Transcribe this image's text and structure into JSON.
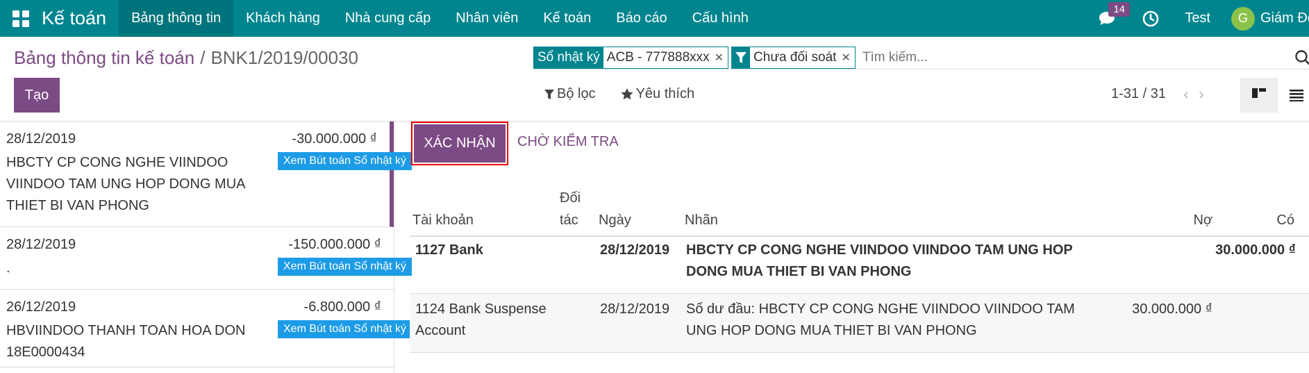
{
  "topbar": {
    "app_name": "Kế toán",
    "menu": [
      "Bảng thông tin",
      "Khách hàng",
      "Nhà cung cấp",
      "Nhân viên",
      "Kế toán",
      "Báo cáo",
      "Cấu hình"
    ],
    "active_menu": "Bảng thông tin",
    "messages_count": "14",
    "company": "Test",
    "avatar_letter": "G",
    "user_name": "Giám Đốc",
    "accent": "#00858e"
  },
  "breadcrumb": {
    "parent": "Bảng thông tin kế toán",
    "separator": "/",
    "current": "BNK1/2019/00030"
  },
  "create_label": "Tạo",
  "search": {
    "facets": [
      {
        "label": "Sổ nhật ký",
        "value": "ACB - 777888xxx",
        "icon": null
      },
      {
        "label": "",
        "value": "Chưa đối soát",
        "icon": "filter-icon"
      }
    ],
    "placeholder": "Tìm kiếm..."
  },
  "filters": {
    "filter_label": "Bộ lọc",
    "favorites_label": "Yêu thích"
  },
  "pager": "1-31 / 31",
  "statement_lines": [
    {
      "date": "28/12/2019",
      "amount": "-30.000.000 ₫",
      "description": "HBCTY CP CONG NGHE VIINDOO VIINDOO TAM UNG HOP DONG MUA THIET BI VAN PHONG",
      "button": "Xem Bút toán Sổ nhật ký"
    },
    {
      "date": "28/12/2019",
      "amount": "-150.000.000 ₫",
      "description": ".",
      "button": "Xem Bút toán Sổ nhật ký"
    },
    {
      "date": "26/12/2019",
      "amount": "-6.800.000 ₫",
      "description": "HBVIINDOO THANH TOAN HOA DON 18E0000434",
      "button": "Xem Bút toán Sổ nhật ký"
    }
  ],
  "actions": {
    "confirm": "XÁC NHẬN",
    "pending": "CHỜ KIỂM TRA"
  },
  "table": {
    "headers": {
      "account": "Tài khoản",
      "partner": "Đối tác",
      "date": "Ngày",
      "label": "Nhãn",
      "debit": "Nợ",
      "credit": "Có"
    },
    "rows": [
      {
        "account": "1127 Bank",
        "date": "28/12/2019",
        "label": "HBCTY CP CONG NGHE VIINDOO VIINDOO TAM UNG HOP DONG MUA THIET BI VAN PHONG",
        "debit": "",
        "credit": "30.000.000 ₫"
      },
      {
        "account": "1124 Bank Suspense Account",
        "date": "28/12/2019",
        "label": "Số dư đầu: HBCTY CP CONG NGHE VIINDOO VIINDOO TAM UNG HOP DONG MUA THIET BI VAN PHONG",
        "debit": "30.000.000 ₫",
        "credit": ""
      }
    ]
  }
}
